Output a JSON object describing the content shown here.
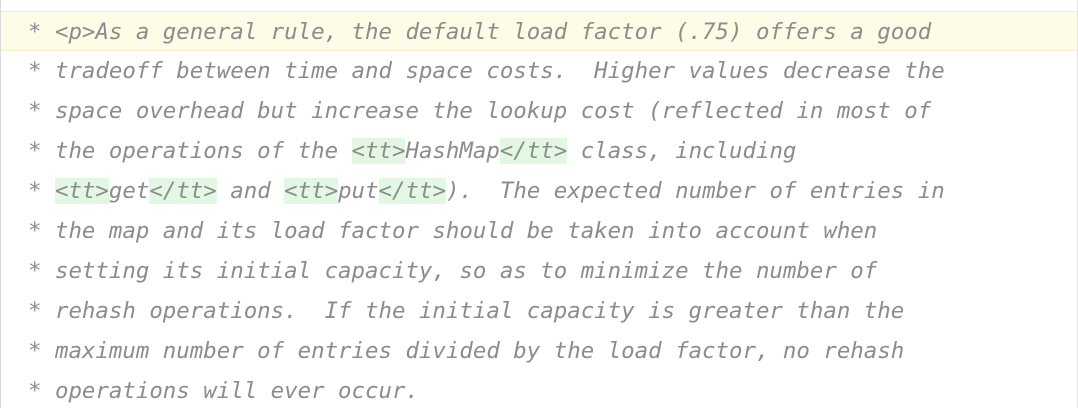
{
  "editor": {
    "lines": [
      {
        "prefix": "* ",
        "segments": [
          {
            "t": "<p>As a general rule, the default load factor (.75) offers a good",
            "tag": false
          }
        ]
      },
      {
        "prefix": "* ",
        "segments": [
          {
            "t": "tradeoff between time and space costs.  Higher values decrease the",
            "tag": false
          }
        ]
      },
      {
        "prefix": "* ",
        "segments": [
          {
            "t": "space overhead but increase the lookup cost (reflected in most of",
            "tag": false
          }
        ]
      },
      {
        "prefix": "* ",
        "segments": [
          {
            "t": "the operations of the ",
            "tag": false
          },
          {
            "t": "<tt>",
            "tag": true
          },
          {
            "t": "HashMap",
            "tag": false
          },
          {
            "t": "</tt>",
            "tag": true
          },
          {
            "t": " class, including",
            "tag": false
          }
        ]
      },
      {
        "prefix": "* ",
        "segments": [
          {
            "t": "<tt>",
            "tag": true
          },
          {
            "t": "get",
            "tag": false
          },
          {
            "t": "</tt>",
            "tag": true
          },
          {
            "t": " and ",
            "tag": false
          },
          {
            "t": "<tt>",
            "tag": true
          },
          {
            "t": "put",
            "tag": false
          },
          {
            "t": "</tt>",
            "tag": true
          },
          {
            "t": ").  The expected number of entries in",
            "tag": false
          }
        ]
      },
      {
        "prefix": "* ",
        "segments": [
          {
            "t": "the map and its load factor should be taken into account when",
            "tag": false
          }
        ]
      },
      {
        "prefix": "* ",
        "segments": [
          {
            "t": "setting its initial capacity, so as to minimize the number of",
            "tag": false
          }
        ]
      },
      {
        "prefix": "* ",
        "segments": [
          {
            "t": "rehash operations.  If the initial capacity is greater than the",
            "tag": false
          }
        ]
      },
      {
        "prefix": "* ",
        "segments": [
          {
            "t": "maximum number of entries divided by the load factor, no rehash",
            "tag": false
          }
        ]
      },
      {
        "prefix": "* ",
        "segments": [
          {
            "t": "operations will ever occur.",
            "tag": false
          }
        ]
      }
    ],
    "colors": {
      "comment_text": "#8c8c8c",
      "tag_highlight": "#e2f8e2",
      "current_line_background": "#fefce6",
      "background": "#ffffff"
    }
  }
}
